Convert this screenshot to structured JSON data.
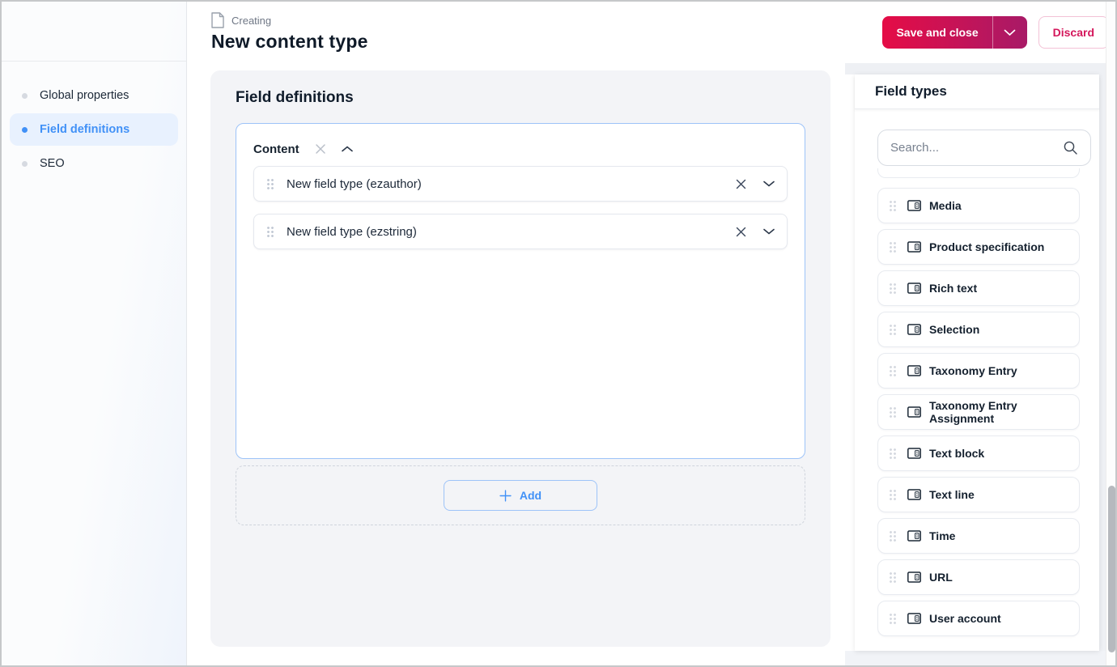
{
  "header": {
    "kicker": "Creating",
    "title": "New content type",
    "save_button": "Save and close",
    "discard_button": "Discard"
  },
  "sidebar": {
    "items": [
      {
        "label": "Global properties",
        "active": false
      },
      {
        "label": "Field definitions",
        "active": true
      },
      {
        "label": "SEO",
        "active": false
      }
    ]
  },
  "main": {
    "section_title": "Field definitions",
    "group": {
      "name": "Content",
      "fields": [
        {
          "label": "New field type (ezauthor)"
        },
        {
          "label": "New field type (ezstring)"
        }
      ]
    },
    "add_button_label": "Add"
  },
  "field_types_panel": {
    "title": "Field types",
    "search_placeholder": "Search...",
    "items": [
      "Media",
      "Product specification",
      "Rich text",
      "Selection",
      "Taxonomy Entry",
      "Taxonomy Entry Assignment",
      "Text block",
      "Text line",
      "Time",
      "URL",
      "User account"
    ]
  },
  "icons": {
    "page-icon": "document-outline",
    "save-caret-icon": "chevron-down",
    "group-remove-icon": "x",
    "group-collapse-icon": "chevron-up",
    "field-remove-icon": "x",
    "field-expand-icon": "chevron-down",
    "add-icon": "plus",
    "search-icon": "magnifier",
    "drag-handle-icon": "six-dots",
    "field-type-icon": "input-stepper"
  },
  "colors": {
    "accent_blue": "#4191f7",
    "active_nav_bg": "#e8f1fe",
    "save_gradient_start": "#e50c46",
    "save_gradient_end": "#a81a67",
    "discard_pink": "#d4175b",
    "main_card_bg": "#f3f4f7",
    "group_border_blue": "#9dc3f8"
  }
}
